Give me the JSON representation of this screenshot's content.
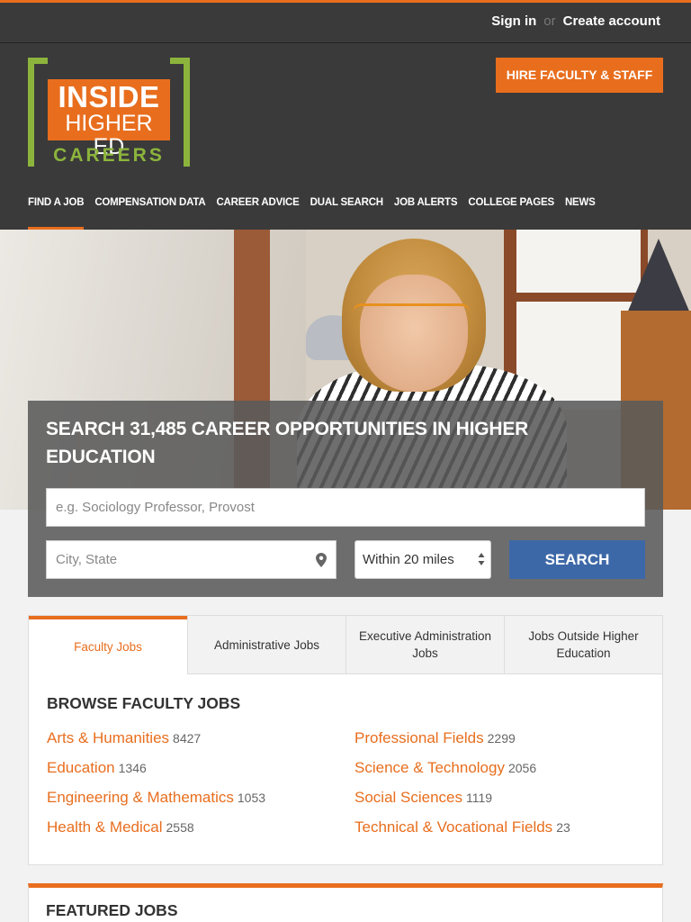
{
  "topbar": {
    "sign_in": "Sign in",
    "or": "or",
    "create_account": "Create account"
  },
  "logo": {
    "line1": "INSIDE",
    "line2": "HIGHER ED",
    "line3": "CAREERS"
  },
  "hire_button": "HIRE FACULTY & STAFF",
  "nav": [
    "FIND A JOB",
    "COMPENSATION DATA",
    "CAREER ADVICE",
    "DUAL SEARCH",
    "JOB ALERTS",
    "COLLEGE PAGES",
    "NEWS"
  ],
  "search": {
    "title": "SEARCH 31,485 CAREER OPPORTUNITIES IN HIGHER EDUCATION",
    "keyword_placeholder": "e.g. Sociology Professor, Provost",
    "location_placeholder": "City, State",
    "distance": "Within 20 miles",
    "button": "SEARCH"
  },
  "tabs": [
    {
      "label": "Faculty Jobs",
      "active": true
    },
    {
      "label": "Administrative Jobs",
      "active": false
    },
    {
      "label": "Executive Administration Jobs",
      "active": false
    },
    {
      "label": "Jobs Outside Higher Education",
      "active": false
    }
  ],
  "browse": {
    "title": "BROWSE FACULTY JOBS",
    "left": [
      {
        "name": "Arts & Humanities",
        "count": "8427"
      },
      {
        "name": "Education",
        "count": "1346"
      },
      {
        "name": "Engineering & Mathematics",
        "count": "1053"
      },
      {
        "name": "Health & Medical",
        "count": "2558"
      }
    ],
    "right": [
      {
        "name": "Professional Fields",
        "count": "2299"
      },
      {
        "name": "Science & Technology",
        "count": "2056"
      },
      {
        "name": "Social Sciences",
        "count": "1119"
      },
      {
        "name": "Technical & Vocational Fields",
        "count": "23"
      }
    ]
  },
  "featured": {
    "title": "FEATURED JOBS"
  },
  "colors": {
    "accent": "#e86e1e",
    "logo_green": "#8cb43c",
    "search_blue": "#3d68a8",
    "dark": "#3a3a3a"
  }
}
